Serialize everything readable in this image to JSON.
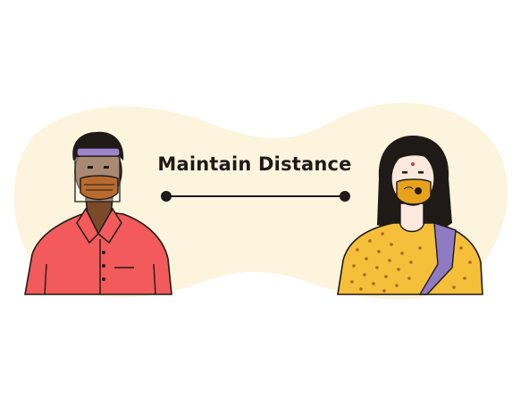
{
  "heading": "Maintain Distance",
  "colors": {
    "blob": "#fcf4dc",
    "outline": "#1f1a17",
    "man_shirt": "#f25a5b",
    "man_skin": "#7a4a2a",
    "man_mask": "#b86a2e",
    "face_shield": "#9b86c9",
    "woman_top": "#f5bf3a",
    "woman_sash": "#8f7ac4",
    "woman_skin": "#fbe9dd",
    "woman_mask": "#e6a21c"
  },
  "icons": {
    "distance_line": "connector-line-with-endpoints",
    "man": "man-with-face-shield-and-mask",
    "woman": "woman-with-face-mask"
  }
}
